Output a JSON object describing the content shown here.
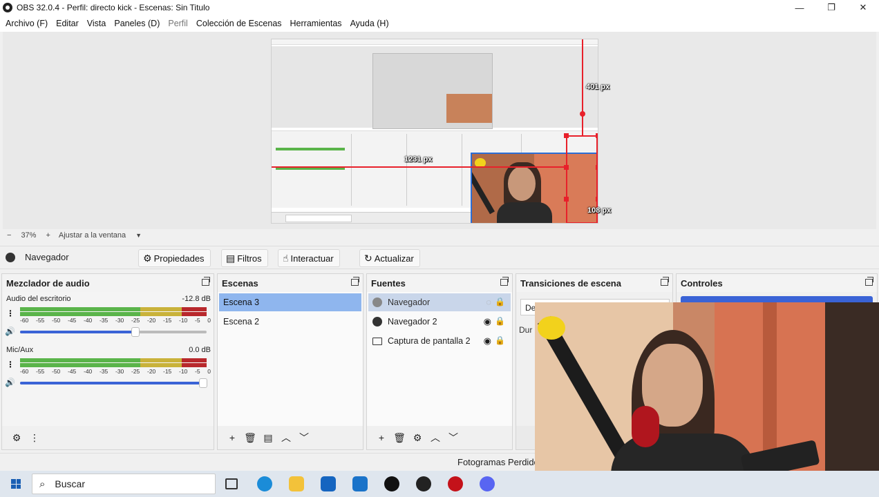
{
  "window": {
    "title": "OBS 32.0.4 - Perfil: directo kick - Escenas: Sin Titulo",
    "minimize": "—",
    "maximize": "❐",
    "close": "✕"
  },
  "menu": {
    "items": [
      "Archivo (F)",
      "Editar",
      "Vista",
      "Paneles (D)",
      "Perfil",
      "Colección de Escenas",
      "Herramientas",
      "Ayuda (H)"
    ]
  },
  "preview": {
    "width_label": "1231 px",
    "top_label": "401 px",
    "right_label": "108 px"
  },
  "zoombar": {
    "minus": "−",
    "zoom": "37%",
    "plus": "+",
    "fit": "Ajustar a la ventana",
    "dropdown_arrow": "▼"
  },
  "source_toolbar": {
    "source_name": "Navegador",
    "properties": "Propiedades",
    "filters": "Filtros",
    "interact": "Interactuar",
    "refresh": "Actualizar"
  },
  "audio_mixer": {
    "title": "Mezclador de audio",
    "channels": [
      {
        "name": "Audio del escritorio",
        "level": "-12.8 dB",
        "volume": 0.62
      },
      {
        "name": "Mic/Aux",
        "level": "0.0 dB",
        "volume": 0.98
      }
    ],
    "ticks": [
      "-60",
      "-55",
      "-50",
      "-45",
      "-40",
      "-35",
      "-30",
      "-25",
      "-20",
      "-15",
      "-10",
      "-5",
      "0"
    ]
  },
  "scenes": {
    "title": "Escenas",
    "items": [
      "Escena 3",
      "Escena 2"
    ],
    "selected": 0
  },
  "sources": {
    "title": "Fuentes",
    "items": [
      {
        "name": "Navegador",
        "icon": "globe-icon",
        "visible": false
      },
      {
        "name": "Navegador 2",
        "icon": "globe-icon",
        "visible": true
      },
      {
        "name": "Captura de pantalla 2",
        "icon": "monitor-icon",
        "visible": true
      }
    ]
  },
  "transitions": {
    "title": "Transiciones de escena",
    "peek_1": "De",
    "peek_2": "Dur"
  },
  "controls": {
    "title": "Controles"
  },
  "statusbar": {
    "text": "Fotogramas Perdido"
  },
  "taskbar": {
    "search_placeholder": "Buscar",
    "apps": [
      "task-view-icon",
      "edge-icon",
      "file-explorer-icon",
      "store-icon",
      "outlook-icon",
      "tiktok-icon",
      "obs-icon",
      "record-icon",
      "discord-icon"
    ]
  },
  "colors": {
    "accent": "#3a63d6",
    "selection": "#e8202a",
    "scene_selected": "#8fb6ee",
    "meter_green": "#5ab44a",
    "meter_yellow": "#c9b23a",
    "meter_red": "#b8282c"
  }
}
